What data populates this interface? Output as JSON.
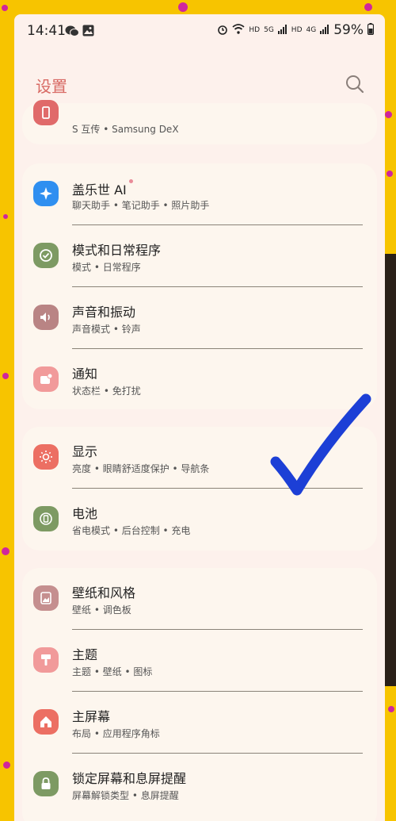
{
  "status_bar": {
    "time": "14:41",
    "network_labels": [
      "HD",
      "5G",
      "HD",
      "4G"
    ],
    "battery": "59%"
  },
  "header": {
    "title": "设置"
  },
  "groups": [
    {
      "items": [
        {
          "title": "",
          "subtitle": "S 互传 • Samsung DeX",
          "icon": "devices-icon",
          "color": "#e06a6a"
        }
      ]
    },
    {
      "items": [
        {
          "title": "盖乐世 AI",
          "subtitle": "聊天助手 • 笔记助手 • 照片助手",
          "icon": "sparkle-icon",
          "color": "#2f8ff0",
          "new_dot": true
        },
        {
          "title": "模式和日常程序",
          "subtitle": "模式 • 日常程序",
          "icon": "check-circle-icon",
          "color": "#7d9a63"
        },
        {
          "title": "声音和振动",
          "subtitle": "声音模式 • 铃声",
          "icon": "speaker-icon",
          "color": "#b98484"
        },
        {
          "title": "通知",
          "subtitle": "状态栏 • 免打扰",
          "icon": "notification-icon",
          "color": "#f19a9a"
        }
      ]
    },
    {
      "items": [
        {
          "title": "显示",
          "subtitle": "亮度 • 眼睛舒适度保护 • 导航条",
          "icon": "sun-icon",
          "color": "#ec6f63"
        },
        {
          "title": "电池",
          "subtitle": "省电模式 • 后台控制 • 充电",
          "icon": "battery-icon",
          "color": "#7d9a63"
        }
      ]
    },
    {
      "items": [
        {
          "title": "壁纸和风格",
          "subtitle": "壁纸 • 调色板",
          "icon": "wallpaper-icon",
          "color": "#c58f8f"
        },
        {
          "title": "主题",
          "subtitle": "主题 • 壁纸 • 图标",
          "icon": "theme-brush-icon",
          "color": "#f19a9a"
        },
        {
          "title": "主屏幕",
          "subtitle": "布局 • 应用程序角标",
          "icon": "home-icon",
          "color": "#ec6f63"
        },
        {
          "title": "锁定屏幕和息屏提醒",
          "subtitle": "屏幕解锁类型 • 息屏提醒",
          "icon": "lock-icon",
          "color": "#7d9a63"
        }
      ]
    }
  ],
  "colors": {
    "background": "#f7c400",
    "polka_dots": "#d0269c",
    "screen": "#fdf1ec",
    "card": "#fdf6ee",
    "title_accent": "#d86a64",
    "checkmark": "#1c3fd6"
  },
  "overlay": {
    "checkmark": "blue-checkmark"
  }
}
